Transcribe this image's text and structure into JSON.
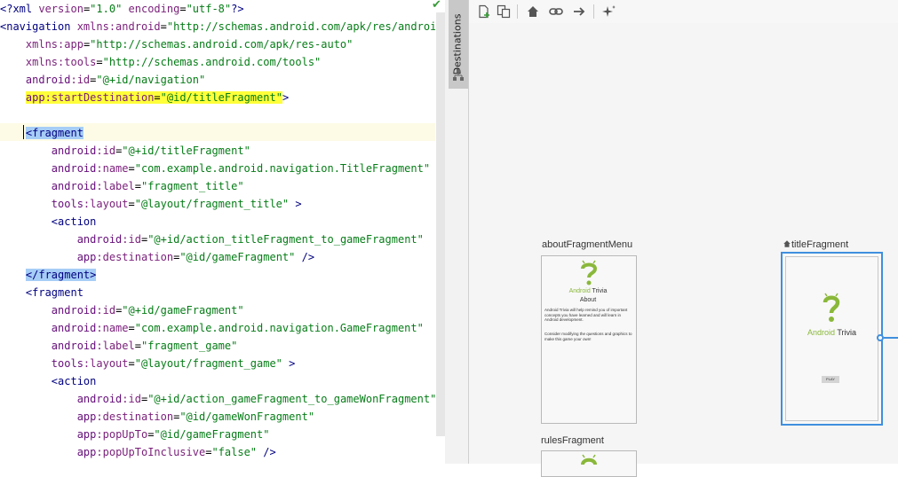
{
  "editor": {
    "lines": [
      {
        "parts": [
          [
            "t-tag",
            "<?xml "
          ],
          [
            "t-attr",
            "version"
          ],
          [
            "t-plain",
            "="
          ],
          [
            "t-str",
            "\"1.0\""
          ],
          [
            "t-plain",
            " "
          ],
          [
            "t-attr",
            "encoding"
          ],
          [
            "t-plain",
            "="
          ],
          [
            "t-str",
            "\"utf-8\""
          ],
          [
            "t-tag",
            "?>"
          ]
        ]
      },
      {
        "parts": [
          [
            "t-tag",
            "<navigation "
          ],
          [
            "t-attr",
            "xmlns:android"
          ],
          [
            "t-plain",
            "="
          ],
          [
            "t-str",
            "\"http://schemas.android.com/apk/res/android\""
          ]
        ]
      },
      {
        "parts": [
          [
            "t-plain",
            "    "
          ],
          [
            "t-attr",
            "xmlns:app"
          ],
          [
            "t-plain",
            "="
          ],
          [
            "t-str",
            "\"http://schemas.android.com/apk/res-auto\""
          ]
        ]
      },
      {
        "parts": [
          [
            "t-plain",
            "    "
          ],
          [
            "t-attr",
            "xmlns:tools"
          ],
          [
            "t-plain",
            "="
          ],
          [
            "t-str",
            "\"http://schemas.android.com/tools\""
          ]
        ]
      },
      {
        "parts": [
          [
            "t-plain",
            "    "
          ],
          [
            "t-ns",
            "android"
          ],
          [
            "t-attr",
            ":id"
          ],
          [
            "t-plain",
            "="
          ],
          [
            "t-str",
            "\"@+id/navigation\""
          ]
        ]
      },
      {
        "parts": [
          [
            "t-plain",
            "    "
          ],
          [
            "t-ns yellow",
            "app"
          ],
          [
            "t-attr yellow",
            ":startDestination"
          ],
          [
            "t-plain yellow",
            "="
          ],
          [
            "t-str yellow",
            "\"@id/titleFragment\""
          ],
          [
            "t-tag",
            ">"
          ]
        ]
      },
      {
        "parts": []
      },
      {
        "parts": [
          [
            "t-plain",
            "    "
          ],
          [
            "t-tag sel",
            "<fragment"
          ]
        ]
      },
      {
        "parts": [
          [
            "t-plain",
            "        "
          ],
          [
            "t-ns",
            "android"
          ],
          [
            "t-attr",
            ":id"
          ],
          [
            "t-plain",
            "="
          ],
          [
            "t-str",
            "\"@+id/titleFragment\""
          ]
        ]
      },
      {
        "parts": [
          [
            "t-plain",
            "        "
          ],
          [
            "t-ns",
            "android"
          ],
          [
            "t-attr",
            ":name"
          ],
          [
            "t-plain",
            "="
          ],
          [
            "t-str",
            "\"com.example.android.navigation.TitleFragment\""
          ]
        ]
      },
      {
        "parts": [
          [
            "t-plain",
            "        "
          ],
          [
            "t-ns",
            "android"
          ],
          [
            "t-attr",
            ":label"
          ],
          [
            "t-plain",
            "="
          ],
          [
            "t-str",
            "\"fragment_title\""
          ]
        ]
      },
      {
        "parts": [
          [
            "t-plain",
            "        "
          ],
          [
            "t-ns",
            "tools"
          ],
          [
            "t-attr",
            ":layout"
          ],
          [
            "t-plain",
            "="
          ],
          [
            "t-str",
            "\"@layout/fragment_title\""
          ],
          [
            "t-plain",
            " "
          ],
          [
            "t-tag",
            ">"
          ]
        ]
      },
      {
        "parts": [
          [
            "t-plain",
            "        "
          ],
          [
            "t-tag",
            "<action"
          ]
        ]
      },
      {
        "parts": [
          [
            "t-plain",
            "            "
          ],
          [
            "t-ns",
            "android"
          ],
          [
            "t-attr",
            ":id"
          ],
          [
            "t-plain",
            "="
          ],
          [
            "t-str",
            "\"@+id/action_titleFragment_to_gameFragment\""
          ]
        ]
      },
      {
        "parts": [
          [
            "t-plain",
            "            "
          ],
          [
            "t-ns",
            "app"
          ],
          [
            "t-attr",
            ":destination"
          ],
          [
            "t-plain",
            "="
          ],
          [
            "t-str",
            "\"@id/gameFragment\""
          ],
          [
            "t-plain",
            " "
          ],
          [
            "t-tag",
            "/>"
          ]
        ]
      },
      {
        "parts": [
          [
            "t-plain",
            "    "
          ],
          [
            "t-tag sel",
            "</fragment>"
          ]
        ]
      },
      {
        "parts": [
          [
            "t-plain",
            "    "
          ],
          [
            "t-tag",
            "<fragment"
          ]
        ]
      },
      {
        "parts": [
          [
            "t-plain",
            "        "
          ],
          [
            "t-ns",
            "android"
          ],
          [
            "t-attr",
            ":id"
          ],
          [
            "t-plain",
            "="
          ],
          [
            "t-str",
            "\"@+id/gameFragment\""
          ]
        ]
      },
      {
        "parts": [
          [
            "t-plain",
            "        "
          ],
          [
            "t-ns",
            "android"
          ],
          [
            "t-attr",
            ":name"
          ],
          [
            "t-plain",
            "="
          ],
          [
            "t-str",
            "\"com.example.android.navigation.GameFragment\""
          ]
        ]
      },
      {
        "parts": [
          [
            "t-plain",
            "        "
          ],
          [
            "t-ns",
            "android"
          ],
          [
            "t-attr",
            ":label"
          ],
          [
            "t-plain",
            "="
          ],
          [
            "t-str",
            "\"fragment_game\""
          ]
        ]
      },
      {
        "parts": [
          [
            "t-plain",
            "        "
          ],
          [
            "t-ns",
            "tools"
          ],
          [
            "t-attr",
            ":layout"
          ],
          [
            "t-plain",
            "="
          ],
          [
            "t-str",
            "\"@layout/fragment_game\""
          ],
          [
            "t-plain",
            " "
          ],
          [
            "t-tag",
            ">"
          ]
        ]
      },
      {
        "parts": [
          [
            "t-plain",
            "        "
          ],
          [
            "t-tag",
            "<action"
          ]
        ]
      },
      {
        "parts": [
          [
            "t-plain",
            "            "
          ],
          [
            "t-ns",
            "android"
          ],
          [
            "t-attr",
            ":id"
          ],
          [
            "t-plain",
            "="
          ],
          [
            "t-str",
            "\"@+id/action_gameFragment_to_gameWonFragment\""
          ]
        ]
      },
      {
        "parts": [
          [
            "t-plain",
            "            "
          ],
          [
            "t-ns",
            "app"
          ],
          [
            "t-attr",
            ":destination"
          ],
          [
            "t-plain",
            "="
          ],
          [
            "t-str",
            "\"@id/gameWonFragment\""
          ]
        ]
      },
      {
        "parts": [
          [
            "t-plain",
            "            "
          ],
          [
            "t-ns",
            "app"
          ],
          [
            "t-attr",
            ":popUpTo"
          ],
          [
            "t-plain",
            "="
          ],
          [
            "t-str",
            "\"@id/gameFragment\""
          ]
        ]
      },
      {
        "parts": [
          [
            "t-plain",
            "            "
          ],
          [
            "t-ns",
            "app"
          ],
          [
            "t-attr",
            ":popUpToInclusive"
          ],
          [
            "t-plain",
            "="
          ],
          [
            "t-str",
            "\"false\""
          ],
          [
            "t-plain",
            " "
          ],
          [
            "t-tag",
            "/>"
          ]
        ]
      }
    ],
    "status_icon": "checkmark-icon"
  },
  "sidetab": {
    "label": "Destinations",
    "icon": "hierarchy-icon"
  },
  "toolbar": {
    "icons": [
      "new-destination-icon",
      "nested-graph-icon",
      "home-icon",
      "link-icon",
      "arrow-right-icon",
      "auto-arrange-icon"
    ]
  },
  "destinations": {
    "about": {
      "label": "aboutFragmentMenu",
      "title_green": "Android",
      "title_gray": "Trivia",
      "subtitle": "About",
      "body1": "Android Trivia will help remind you of important concepts you have learned and will learn in Android development.",
      "body2": "Consider modifying the questions and graphics to make this game your own!"
    },
    "title": {
      "label": "titleFragment",
      "title_green": "Android",
      "title_gray": "Trivia",
      "button": "PLAY"
    },
    "rules": {
      "label": "rulesFragment"
    }
  },
  "colors": {
    "android_green": "#8ab83a",
    "selection_blue": "#3f8fde"
  }
}
